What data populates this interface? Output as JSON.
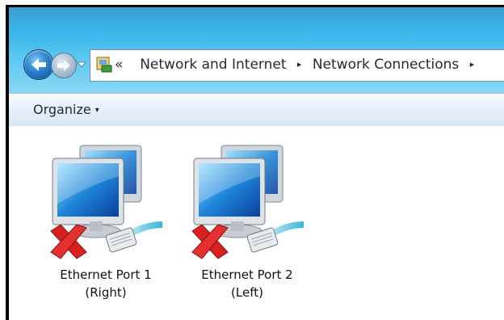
{
  "navigation": {
    "back_icon": "back-arrow-icon",
    "forward_icon": "forward-arrow-icon",
    "history_icon": "chevron-down-icon"
  },
  "address_bar": {
    "icon": "control-panel-icon",
    "overflow": "«",
    "crumbs": [
      "Network and Internet",
      "Network Connections"
    ],
    "separator": "▸"
  },
  "toolbar": {
    "organize_label": "Organize",
    "organize_caret": "▾"
  },
  "connections": [
    {
      "name_line1": "Ethernet Port 1",
      "name_line2": "(Right)",
      "status": "disconnected"
    },
    {
      "name_line1": "Ethernet Port 2",
      "name_line2": "(Left)",
      "status": "disconnected"
    }
  ],
  "colors": {
    "titlebar": "#2fb1e8",
    "toolbar": "#e4eef8",
    "disconnect_x": "#d82020"
  }
}
